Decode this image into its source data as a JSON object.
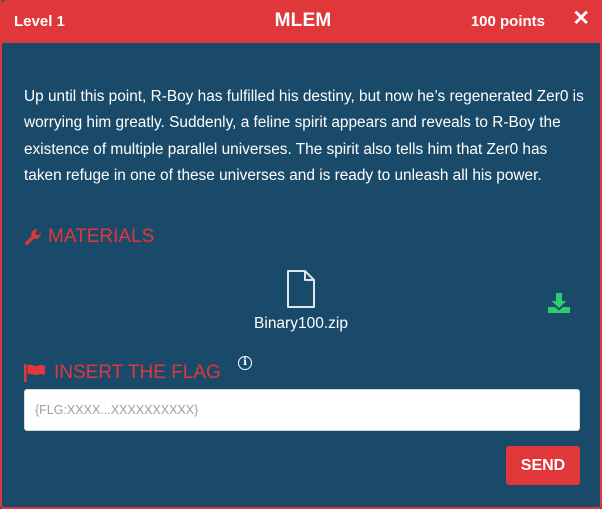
{
  "header": {
    "level": "Level 1",
    "title": "MLEM",
    "points": "100 points",
    "close_icon": "close-icon"
  },
  "description": "Up until this point, R-Boy has fulfilled his destiny, but now he’s regenerated Zer0 is worrying him greatly. Suddenly, a feline spirit appears and reveals to R-Boy the existence of multiple parallel universes. The spirit also tells him that Zer0 has taken refuge in one of these universes and is ready to unleash all his power.",
  "materials": {
    "title": "MATERIALS",
    "icon": "wrench-icon",
    "file": {
      "name": "Binary100.zip",
      "icon": "file-icon",
      "download_icon": "download-icon"
    }
  },
  "flag": {
    "title": "INSERT THE FLAG",
    "icon": "flag-icon",
    "info_icon": "info-icon",
    "placeholder": "{FLG:XXXX...XXXXXXXXXX}",
    "value": "",
    "submit_label": "SEND"
  },
  "colors": {
    "accent": "#e0373a",
    "background": "#1a4a69",
    "download": "#2ecc71"
  }
}
